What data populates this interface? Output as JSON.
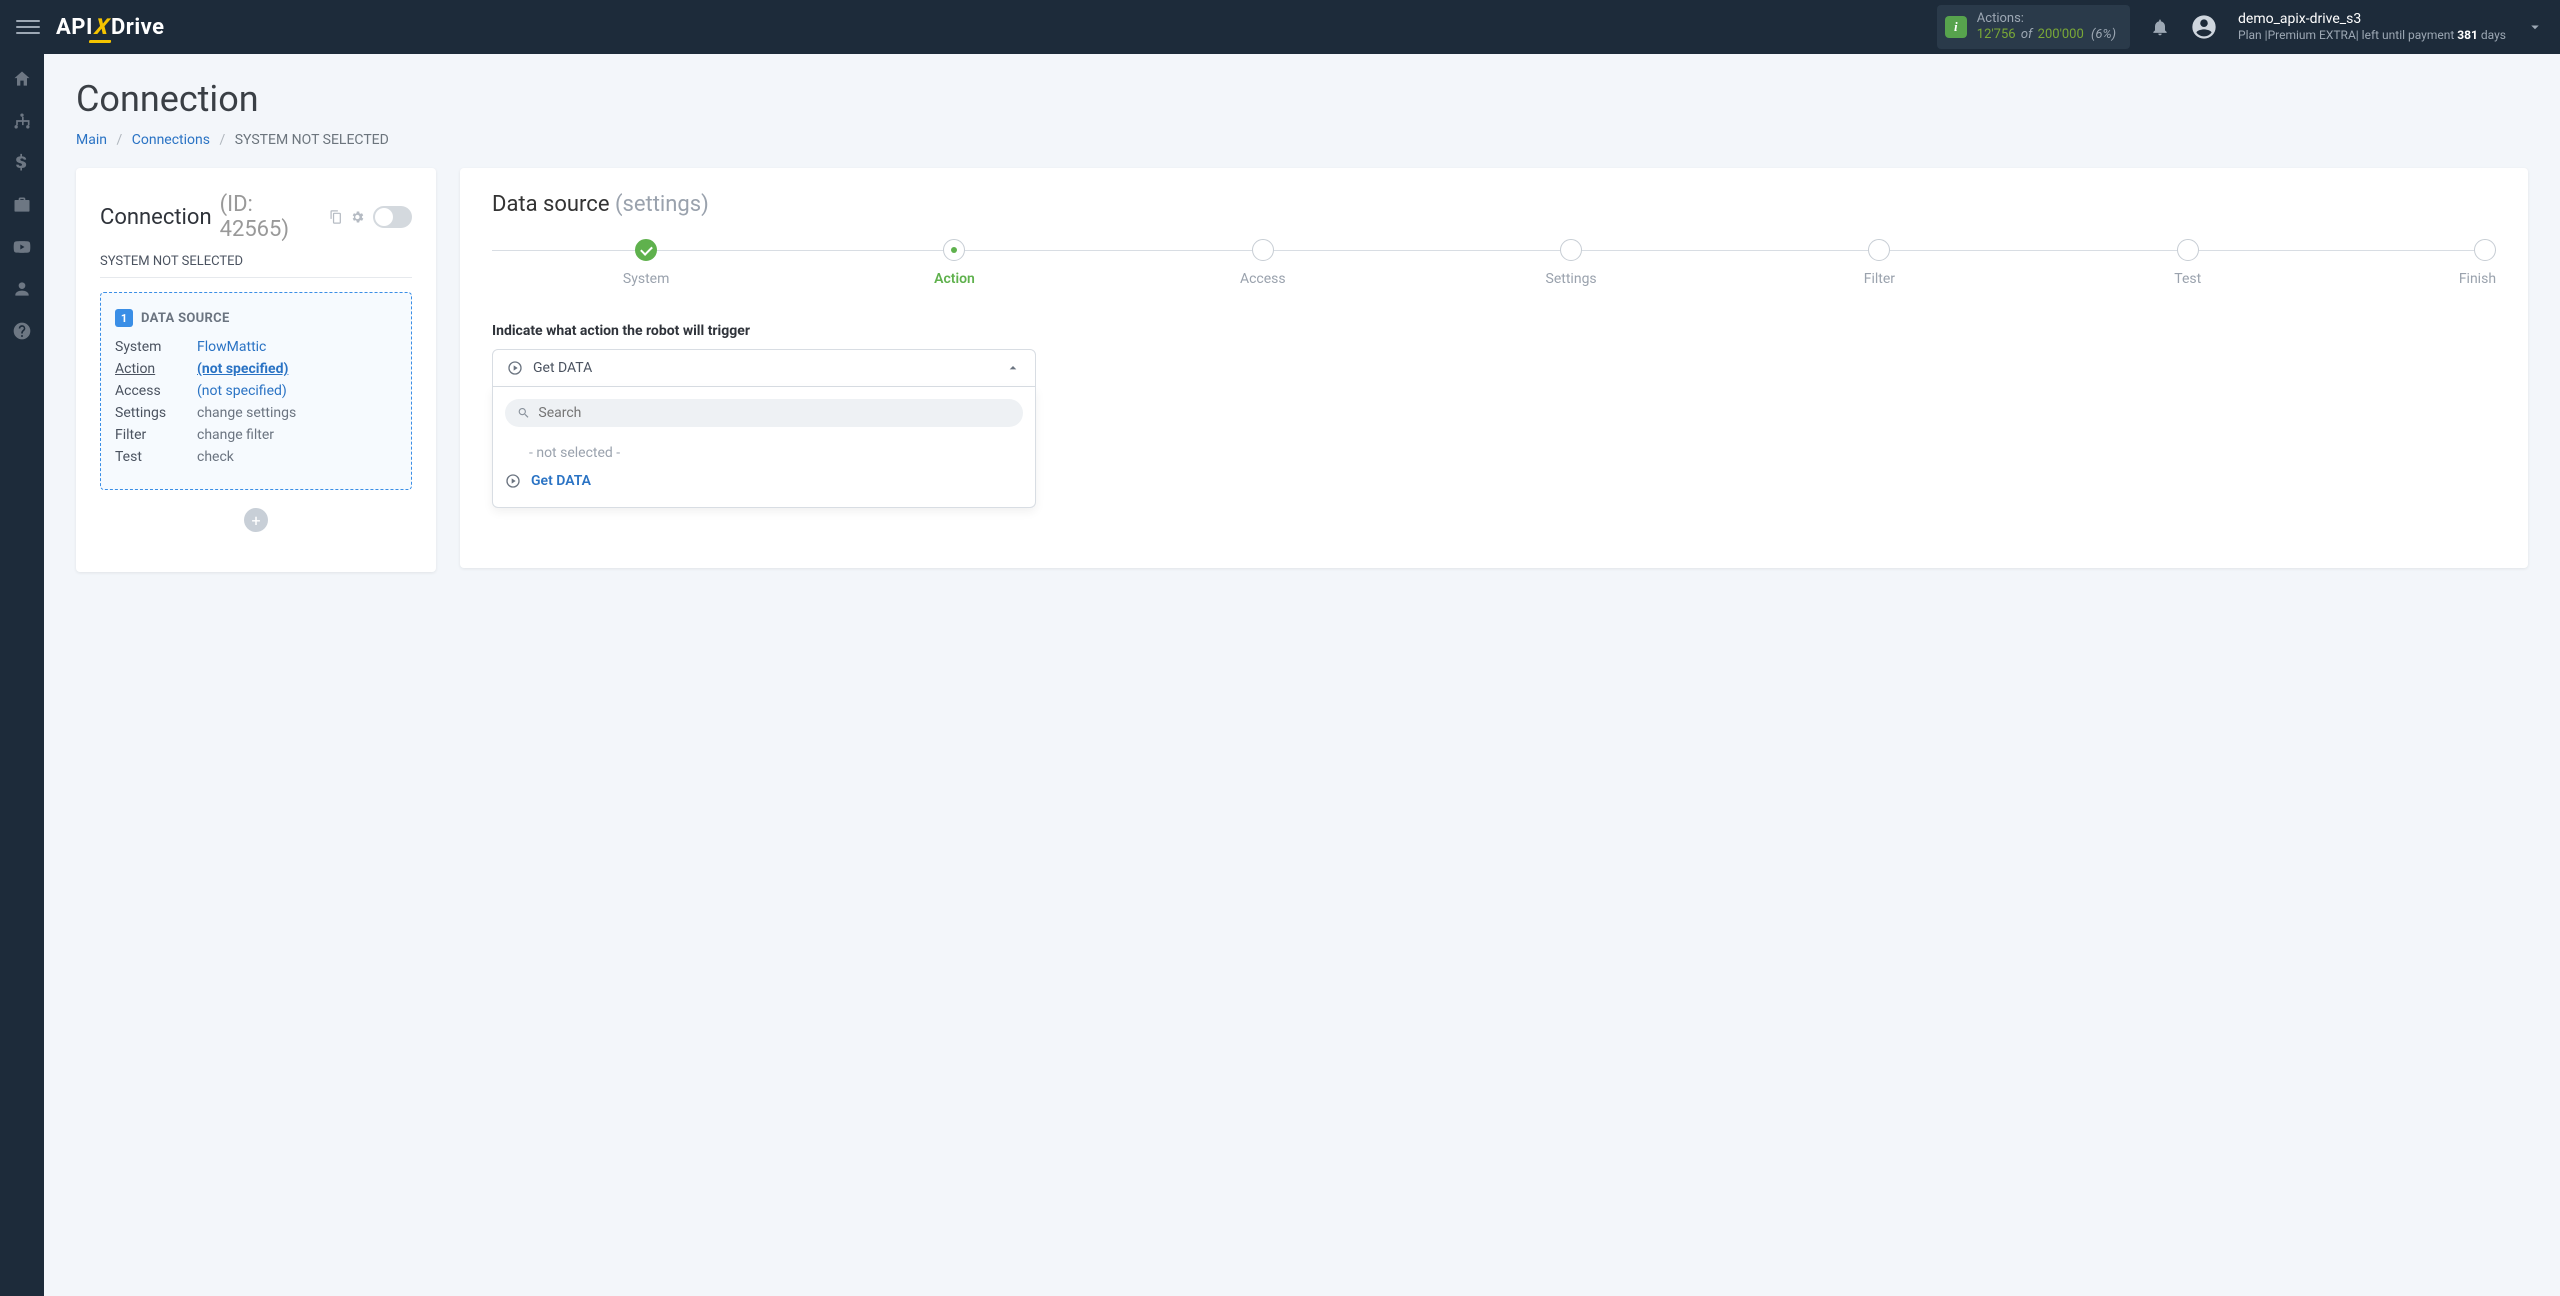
{
  "header": {
    "logo_api": "API",
    "logo_x": "X",
    "logo_drive": "Drive",
    "actions_label": "Actions:",
    "actions_current": "12'756",
    "actions_of": "of",
    "actions_max": "200'000",
    "actions_pct": "(6%)",
    "account_name": "demo_apix-drive_s3",
    "plan_prefix": "Plan  |",
    "plan_name": "Premium EXTRA",
    "plan_suffix": "|  left until payment ",
    "plan_days": "381",
    "plan_days_word": " days"
  },
  "page": {
    "title": "Connection",
    "crumb_main": "Main",
    "crumb_connections": "Connections",
    "crumb_current": "SYSTEM NOT SELECTED"
  },
  "left": {
    "title": "Connection",
    "id": "(ID: 42565)",
    "subtitle": "SYSTEM NOT SELECTED",
    "ds_number": "1",
    "ds_label": "DATA SOURCE",
    "rows": {
      "system_k": "System",
      "system_v": "FlowMattic",
      "action_k": "Action",
      "action_v": "(not specified)",
      "access_k": "Access",
      "access_v": "(not specified)",
      "settings_k": "Settings",
      "settings_v": "change settings",
      "filter_k": "Filter",
      "filter_v": "change filter",
      "test_k": "Test",
      "test_v": "check"
    }
  },
  "right": {
    "title": "Data source",
    "subtitle": "(settings)",
    "steps": [
      "System",
      "Action",
      "Access",
      "Settings",
      "Filter",
      "Test",
      "Finish"
    ],
    "form_label": "Indicate what action the robot will trigger",
    "selected": "Get DATA",
    "search_placeholder": "Search",
    "opt_none": "- not selected -",
    "opt_get": "Get DATA"
  }
}
